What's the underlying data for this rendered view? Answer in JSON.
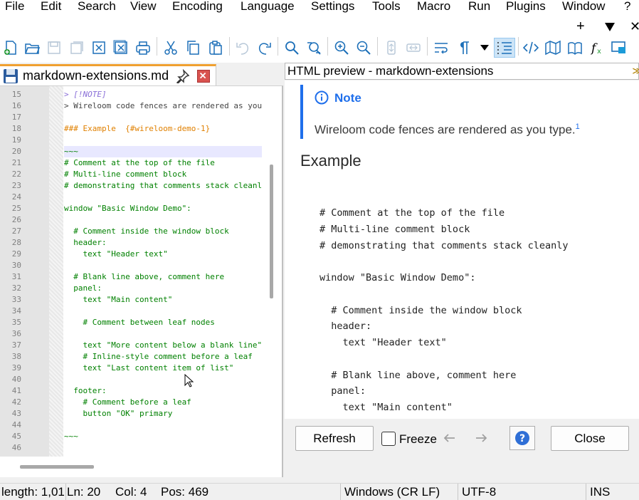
{
  "menu": [
    "File",
    "Edit",
    "Search",
    "View",
    "Encoding",
    "Language",
    "Settings",
    "Tools",
    "Macro",
    "Run",
    "Plugins",
    "Window",
    "?"
  ],
  "menu_extra": {
    "plus": "+",
    "close": "✕"
  },
  "tab": {
    "label": "markdown-extensions.md"
  },
  "editor": {
    "lines": [
      {
        "n": "15",
        "text": "> [!NOTE]",
        "style": "note"
      },
      {
        "n": "16",
        "text": "> Wireloom code fences are rendered as you",
        "style": "quote"
      },
      {
        "n": "17",
        "text": "",
        "style": "plain"
      },
      {
        "n": "18",
        "text": "### Example  {#wireloom-demo-1}",
        "style": "heading"
      },
      {
        "n": "19",
        "text": "",
        "style": "plain"
      },
      {
        "n": "20",
        "text": "~~~",
        "style": "active"
      },
      {
        "n": "21",
        "text": "# Comment at the top of the file",
        "style": "green"
      },
      {
        "n": "22",
        "text": "# Multi-line comment block",
        "style": "green"
      },
      {
        "n": "23",
        "text": "# demonstrating that comments stack cleanl",
        "style": "green"
      },
      {
        "n": "24",
        "text": "",
        "style": "plain"
      },
      {
        "n": "25",
        "text": "window \"Basic Window Demo\":",
        "style": "green"
      },
      {
        "n": "26",
        "text": "",
        "style": "plain"
      },
      {
        "n": "27",
        "text": "  # Comment inside the window block",
        "style": "green"
      },
      {
        "n": "28",
        "text": "  header:",
        "style": "green"
      },
      {
        "n": "29",
        "text": "    text \"Header text\"",
        "style": "green"
      },
      {
        "n": "30",
        "text": "",
        "style": "plain"
      },
      {
        "n": "31",
        "text": "  # Blank line above, comment here",
        "style": "green"
      },
      {
        "n": "32",
        "text": "  panel:",
        "style": "green"
      },
      {
        "n": "33",
        "text": "    text \"Main content\"",
        "style": "green"
      },
      {
        "n": "34",
        "text": "",
        "style": "plain"
      },
      {
        "n": "35",
        "text": "    # Comment between leaf nodes",
        "style": "green"
      },
      {
        "n": "36",
        "text": "",
        "style": "plain"
      },
      {
        "n": "37",
        "text": "    text \"More content below a blank line\"",
        "style": "green"
      },
      {
        "n": "38",
        "text": "    # Inline-style comment before a leaf",
        "style": "green"
      },
      {
        "n": "39",
        "text": "    text \"Last content item of list\"",
        "style": "green"
      },
      {
        "n": "40",
        "text": "",
        "style": "plain"
      },
      {
        "n": "41",
        "text": "  footer:",
        "style": "green"
      },
      {
        "n": "42",
        "text": "    # Comment before a leaf",
        "style": "green"
      },
      {
        "n": "43",
        "text": "    button \"OK\" primary",
        "style": "green"
      },
      {
        "n": "44",
        "text": "",
        "style": "plain"
      },
      {
        "n": "45",
        "text": "~~~",
        "style": "green"
      },
      {
        "n": "46",
        "text": "",
        "style": "plain"
      }
    ]
  },
  "preview": {
    "title": "HTML preview - markdown-extensions",
    "note_label": "Note",
    "note_text": "Wireloom code fences are rendered as you type.",
    "note_sup": "1",
    "heading": "Example",
    "code_lines": [
      "# Comment at the top of the file",
      "# Multi-line comment block",
      "# demonstrating that comments stack cleanly",
      "",
      "window \"Basic Window Demo\":",
      "",
      "  # Comment inside the window block",
      "  header:",
      "    text \"Header text\"",
      "",
      "  # Blank line above, comment here",
      "  panel:",
      "    text \"Main content\""
    ]
  },
  "buttons": {
    "refresh": "Refresh",
    "freeze": "Freeze",
    "close": "Close"
  },
  "status": {
    "length": "length: 1,01",
    "line": "Ln: 20",
    "col": "Col: 4",
    "pos": "Pos: 469",
    "eol": "Windows (CR LF)",
    "encoding": "UTF-8",
    "mode": "INS"
  },
  "colors": {
    "accent": "#1f6feb",
    "tab_marker": "#f0a030",
    "toolbar_icon": "#1c6fb8"
  }
}
